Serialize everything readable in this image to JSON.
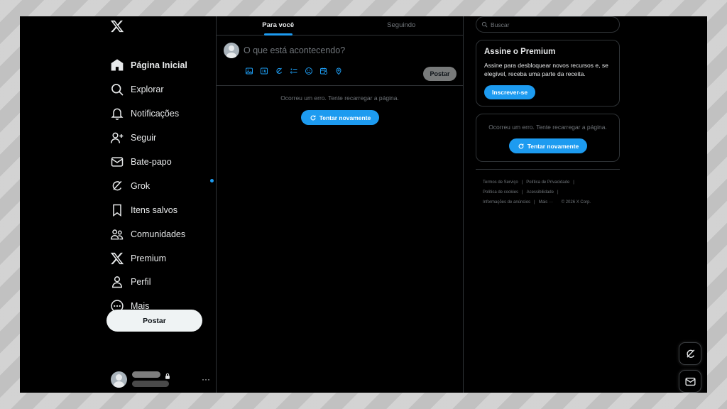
{
  "sidebar": {
    "nav": [
      {
        "label": "Página Inicial",
        "icon": "home-icon",
        "active": true
      },
      {
        "label": "Explorar",
        "icon": "search-icon"
      },
      {
        "label": "Notificações",
        "icon": "bell-icon"
      },
      {
        "label": "Seguir",
        "icon": "follow-icon"
      },
      {
        "label": "Bate-papo",
        "icon": "envelope-icon"
      },
      {
        "label": "Grok",
        "icon": "grok-icon"
      },
      {
        "label": "Itens salvos",
        "icon": "bookmark-icon"
      },
      {
        "label": "Comunidades",
        "icon": "communities-icon"
      },
      {
        "label": "Premium",
        "icon": "x-logo-icon"
      },
      {
        "label": "Perfil",
        "icon": "profile-icon"
      },
      {
        "label": "Mais",
        "icon": "more-circle-icon"
      }
    ],
    "post_label": "Postar",
    "account_more": "···"
  },
  "main": {
    "tabs": [
      {
        "label": "Para você",
        "active": true
      },
      {
        "label": "Seguindo",
        "active": false
      }
    ],
    "composer": {
      "placeholder": "O que está acontecendo?",
      "post_label": "Postar",
      "tools": [
        "image-icon",
        "gif-icon",
        "grok-enhance-icon",
        "poll-icon",
        "emoji-icon",
        "schedule-icon",
        "location-icon"
      ]
    },
    "error_text": "Ocorreu um erro. Tente recarregar a página.",
    "retry_label": "Tentar novamente"
  },
  "right": {
    "search_placeholder": "Buscar",
    "premium": {
      "title": "Assine o Premium",
      "description": "Assine para desbloquear novos recursos e, se elegível, receba uma parte da receita.",
      "button": "Inscrever-se"
    },
    "trends": {
      "error_text": "Ocorreu um erro. Tente recarregar a página.",
      "retry_label": "Tentar novamente"
    },
    "footer": {
      "terms": "Termos de Serviço",
      "privacy": "Política de Privacidade",
      "cookies": "Política de cookies",
      "accessibility": "Acessibilidade",
      "ads": "Informações de anúncios",
      "more": "Mais ···",
      "copyright": "© 2026 X Corp."
    }
  },
  "colors": {
    "accent": "#1d9bf0",
    "background": "#000000",
    "border": "#2f3336",
    "text": "#e7e9ea",
    "muted": "#71767b"
  }
}
